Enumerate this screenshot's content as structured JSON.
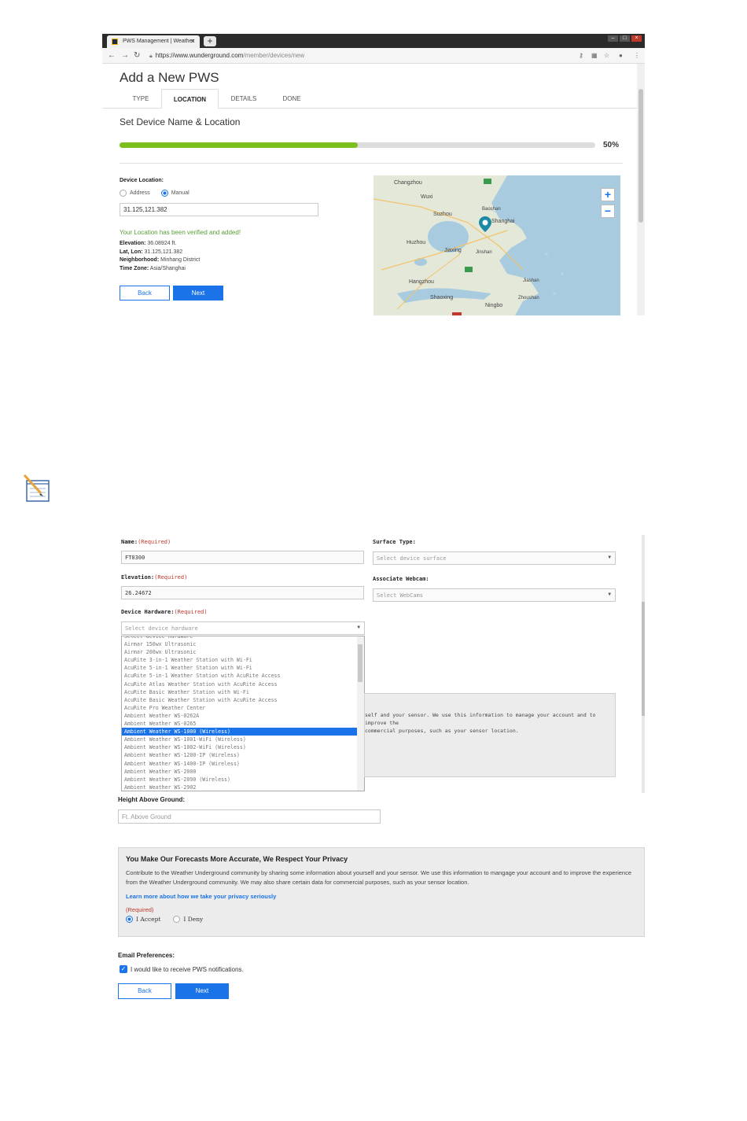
{
  "browser": {
    "tab_title": "PWS Management | Weather",
    "tab_close": "×",
    "new_tab": "+",
    "url_host": "https://www.wunderground.com",
    "url_path": "/member/devices/new"
  },
  "add_pws": {
    "title": "Add a New PWS",
    "steps": [
      "TYPE",
      "LOCATION",
      "DETAILS",
      "DONE"
    ],
    "active_step": "LOCATION",
    "section_title": "Set Device Name & Location",
    "progress_percent": 50,
    "progress_label": "50%",
    "device_location_label": "Device Location:",
    "radio_address": "Address",
    "radio_manual": "Manual",
    "selected_mode": "Manual",
    "coords_value": "31.125,121.382",
    "verified_msg": "Your Location has been verified and added!",
    "elevation_label": "Elevation:",
    "elevation_value": "36.08924 ft.",
    "latlon_label": "Lat, Lon:",
    "latlon_value": "31.125,121.382",
    "neighborhood_label": "Neighborhood:",
    "neighborhood_value": "Minhang District",
    "timezone_label": "Time Zone:",
    "timezone_value": "Asia/Shanghai",
    "back": "Back",
    "next": "Next",
    "map": {
      "labels": [
        "Changzhou",
        "Wuxi",
        "Suzhou",
        "Baoshan",
        "Shanghai",
        "Huzhou",
        "Jiaxing",
        "Jinshan",
        "Hangzhou",
        "Shaoxing",
        "Ningbo",
        "Jiashan",
        "Zhoushan"
      ],
      "zoom_in": "+",
      "zoom_out": "−"
    }
  },
  "details_form": {
    "name_label": "Name:",
    "required": "(Required)",
    "name_value": "FT0300",
    "elevation_label": "Elevation:",
    "elevation_value": "26.24672",
    "hardware_label": "Device Hardware:",
    "hardware_placeholder": "Select device hardware",
    "surface_label": "Surface Type:",
    "surface_placeholder": "Select device surface",
    "webcam_label": "Associate Webcam:",
    "webcam_placeholder": "Select WebCams",
    "hardware_options": [
      "Select device hardware",
      "Airmar 150wx Ultrasonic",
      "Airmar 200wx Ultrasonic",
      "AcuRite 3-in-1 Weather Station with Wi-Fi",
      "AcuRite 5-in-1 Weather Station with Wi-Fi",
      "AcuRite 5-in-1 Weather Station with AcuRite Access",
      "AcuRite Atlas Weather Station with AcuRite Access",
      "AcuRite Basic Weather Station with Wi-Fi",
      "AcuRite Basic Weather Station with AcuRite Access",
      "AcuRite Pro Weather Center",
      "Ambient Weather WS-0262A",
      "Ambient Weather WS-0265",
      "Ambient Weather WS-1000 (Wireless)",
      "Ambient Weather WS-1001-WiFi (Wireless)",
      "Ambient Weather WS-1002-WiFi (Wireless)",
      "Ambient Weather WS-1200-IP (Wireless)",
      "Ambient Weather WS-1400-IP (Wireless)",
      "Ambient Weather WS-2000",
      "Ambient Weather WS-2090 (Wireless)",
      "Ambient Weather WS-2902"
    ],
    "selected_option": "Ambient Weather WS-1000 (Wireless)",
    "partial_line1": "self and your sensor. We use this information to manage your account and to improve the",
    "partial_line2": "commercial purposes, such as your sensor location."
  },
  "privacy_form": {
    "height_label": "Height Above Ground:",
    "height_placeholder": "Ft. Above Ground",
    "privacy_title": "You Make Our Forecasts More Accurate, We Respect Your Privacy",
    "privacy_body": "Contribute to the Weather Underground community by sharing some information about yourself and your sensor. We use this information to mangage your account and to improve the experience from the Weather Underground community. We may also share certain data for commercial purposes, such as your sensor location.",
    "privacy_link": "Learn more about how we take your privacy seriously",
    "required": "(Required)",
    "accept": "I Accept",
    "deny": "I Deny",
    "selected": "I Accept",
    "email_pref_label": "Email Preferences:",
    "email_checkbox": "I would like to receive PWS notifications.",
    "email_checked": true,
    "back": "Back",
    "next": "Next"
  },
  "colors": {
    "accent": "#1a73e8",
    "progress": "#7cbf1e",
    "verified": "#5aa03a",
    "required": "#c0392b"
  }
}
